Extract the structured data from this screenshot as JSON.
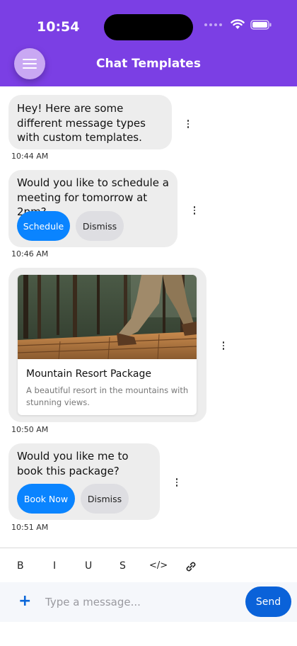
{
  "status_bar": {
    "time": "10:54"
  },
  "header": {
    "title": "Chat Templates"
  },
  "messages": [
    {
      "text": "Hey! Here are some different message types with custom templates.",
      "time": "10:44 AM"
    },
    {
      "text": "Would you like to schedule a meeting for tomorrow at 2pm?",
      "time": "10:46 AM",
      "actions": [
        "Schedule",
        "Dismiss"
      ]
    },
    {
      "card": {
        "title": "Mountain Resort Package",
        "description": "A beautiful resort in the mountains with stunning views."
      },
      "time": "10:50 AM"
    },
    {
      "text": "Would you like me to book this package?",
      "time": "10:51 AM",
      "actions": [
        "Book Now",
        "Dismiss"
      ]
    }
  ],
  "toolbar": {
    "bold": "B",
    "italic": "I",
    "underline": "U",
    "strike": "S",
    "code": "</>"
  },
  "composer": {
    "plus": "+",
    "placeholder": "Type a message...",
    "send_label": "Send"
  },
  "colors": {
    "header": "#7b3fe4",
    "primary_button": "#0a84ff",
    "send_button": "#0a62d9",
    "bubble": "#ededed"
  }
}
